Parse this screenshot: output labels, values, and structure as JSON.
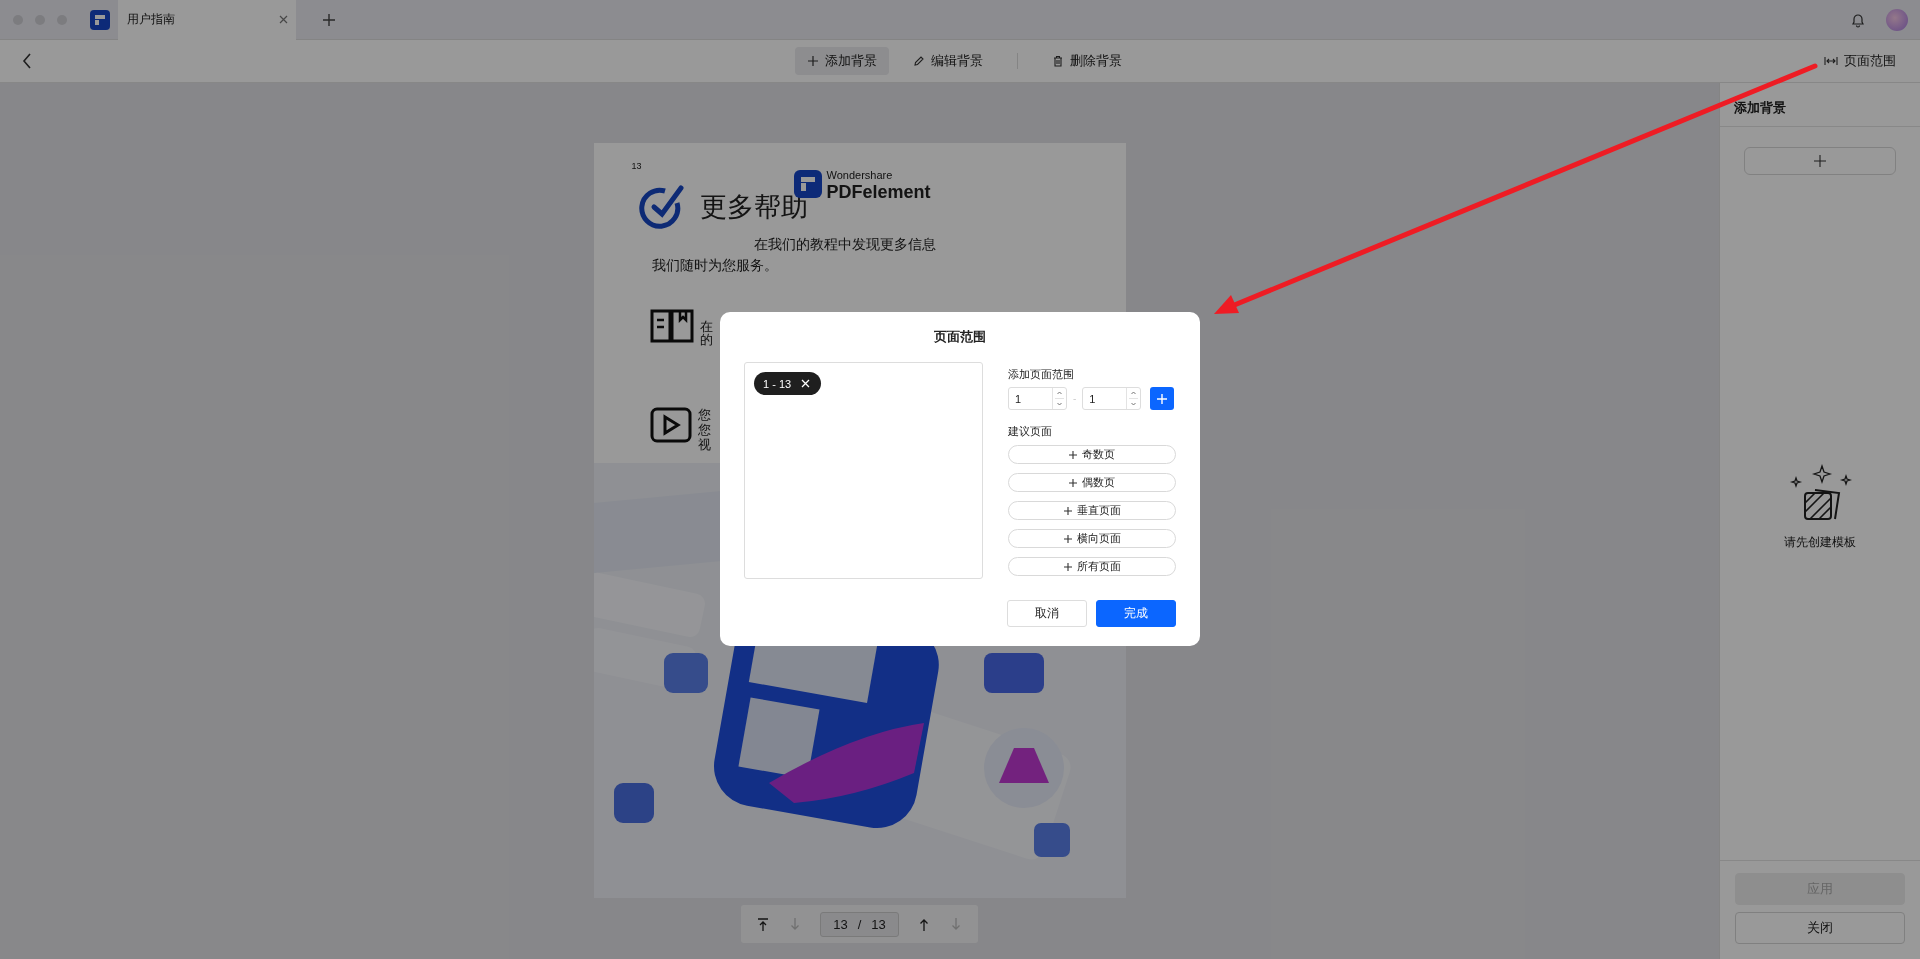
{
  "window": {
    "tab": {
      "title": "用户指南",
      "selected": true
    }
  },
  "toolbar": {
    "tools": [
      {
        "kind": "add",
        "label": "添加背景",
        "selected": true
      },
      {
        "kind": "edit",
        "label": "编辑背景",
        "selected": false
      },
      {
        "kind": "delete",
        "label": "删除背景",
        "selected": false
      }
    ],
    "page_range_button": "页面范围"
  },
  "document": {
    "page_number": "13",
    "heading": "更多帮助",
    "brand_top": "Wondershare",
    "brand_name": "PDFelement",
    "subtitle": "在我们的教程中发现更多信息",
    "intro": "我们随时为您服务。",
    "cut_lines": [
      {
        "kind": "book",
        "lines": [
          "在",
          "的"
        ]
      },
      {
        "kind": "video",
        "lines": [
          "您",
          "您",
          "视"
        ]
      }
    ]
  },
  "page_nav": {
    "buttons_before": [
      {
        "kind": "first",
        "disabled": false
      },
      {
        "kind": "down",
        "disabled": true
      }
    ],
    "current": "13",
    "separator": "/",
    "total": "13",
    "buttons_after": [
      {
        "kind": "up",
        "disabled": false
      },
      {
        "kind": "down",
        "disabled": true
      }
    ]
  },
  "side_panel": {
    "title": "添加背景",
    "empty_text": "请先创建模板",
    "buttons": [
      {
        "label": "应用",
        "disabled": true
      },
      {
        "label": "关闭",
        "disabled": false
      }
    ]
  },
  "dialog": {
    "title": "页面范围",
    "ranges": [
      {
        "label": "1 - 13"
      }
    ],
    "add_label": "添加页面范围",
    "from": "1",
    "range_separator": "-",
    "to": "1",
    "suggest_label": "建议页面",
    "suggestions": [
      {
        "label": "奇数页"
      },
      {
        "label": "偶数页"
      },
      {
        "label": "垂直页面"
      },
      {
        "label": "横向页面"
      },
      {
        "label": "所有页面"
      }
    ],
    "cancel": "取消",
    "confirm": "完成"
  }
}
